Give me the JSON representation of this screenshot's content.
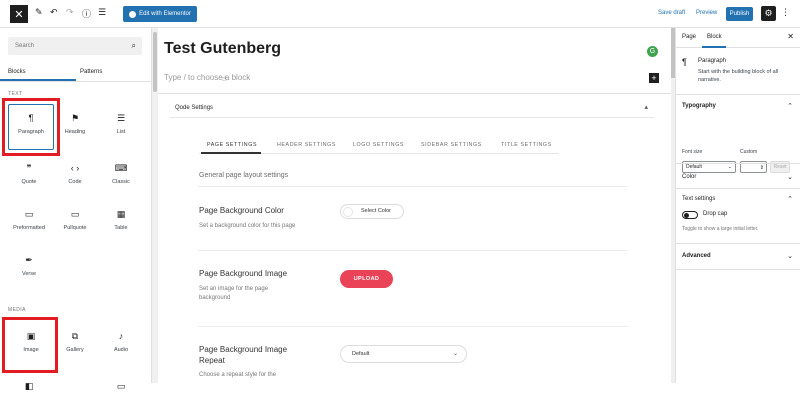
{
  "topbar": {
    "close_icon": "W-close",
    "elementor_label": "Edit with Elementor",
    "save_draft": "Save draft",
    "preview": "Preview",
    "publish": "Publish"
  },
  "inserter": {
    "search_placeholder": "Search",
    "tabs": [
      "Blocks",
      "Patterns"
    ],
    "categories": {
      "text": "TEXT",
      "media": "MEDIA"
    },
    "text_blocks": [
      {
        "label": "Paragraph",
        "icon": "¶"
      },
      {
        "label": "Heading",
        "icon": "▼"
      },
      {
        "label": "List",
        "icon": "☰"
      },
      {
        "label": "Quote",
        "icon": "❞"
      },
      {
        "label": "Code",
        "icon": "‹›"
      },
      {
        "label": "Classic",
        "icon": "⌨"
      },
      {
        "label": "Preformatted",
        "icon": "▭"
      },
      {
        "label": "Pullquote",
        "icon": "▭"
      },
      {
        "label": "Table",
        "icon": "▦"
      },
      {
        "label": "Verse",
        "icon": "✒"
      }
    ],
    "media_blocks": [
      {
        "label": "Image",
        "icon": "▣"
      },
      {
        "label": "Gallery",
        "icon": "⧉"
      },
      {
        "label": "Audio",
        "icon": "♪"
      }
    ]
  },
  "editor": {
    "post_title": "Test Gutenberg",
    "placeholder": "Type / to choose a block",
    "qode_title": "Qode Settings",
    "qode_tabs": [
      "PAGE SETTINGS",
      "HEADER SETTINGS",
      "LOGO SETTINGS",
      "SIDEBAR SETTINGS",
      "TITLE SETTINGS"
    ],
    "section_title": "General page layout settings",
    "options": {
      "bg_color_title": "Page Background Color",
      "bg_color_desc": "Set a background color for this page",
      "select_color": "Select Color",
      "bg_image_title": "Page Background Image",
      "bg_image_desc": "Set an image for the page background",
      "upload": "UPLOAD",
      "bg_repeat_title": "Page Background Image Repeat",
      "bg_repeat_desc": "Choose a repeat style for the",
      "repeat_value": "Default"
    }
  },
  "sidebar": {
    "tabs": [
      "Page",
      "Block"
    ],
    "block_name": "Paragraph",
    "block_desc": "Start with the building block of all narrative.",
    "typography": "Typography",
    "font_size_label": "Font size",
    "custom_label": "Custom",
    "font_size_value": "Default",
    "reset": "Reset",
    "color": "Color",
    "text_settings": "Text settings",
    "drop_cap": "Drop cap",
    "drop_cap_help": "Toggle to show a large initial letter.",
    "advanced": "Advanced"
  }
}
